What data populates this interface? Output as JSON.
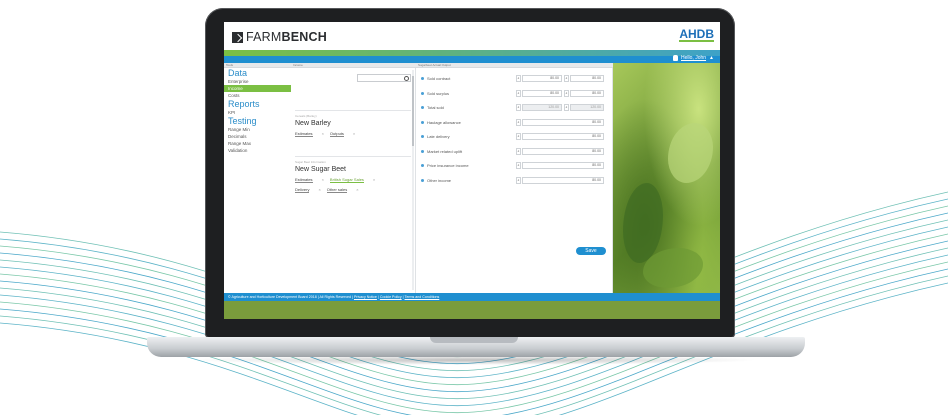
{
  "colors": {
    "brand_blue": "#1f8fd0",
    "brand_green": "#7bbf43",
    "heading_blue": "#2b8dc9"
  },
  "header": {
    "logo_left": "FARM",
    "logo_right": "BENCH",
    "logo_mark_icon": "farmbench-logo-icon",
    "partner_logo": "AHDB",
    "user_greeting": "Hello, John",
    "user_icon": "person-icon",
    "dropdown_icon": "chevron-down-icon"
  },
  "panels": {
    "tools_title": "Tools",
    "middle_title": "Income",
    "right_title": "Sugarbeet Actual Output"
  },
  "sidebar": {
    "sections": [
      {
        "heading": "Data",
        "items": [
          {
            "label": "Enterprise",
            "active": false
          },
          {
            "label": "Income",
            "active": true
          },
          {
            "label": "Costs",
            "active": false
          }
        ]
      },
      {
        "heading": "Reports",
        "items": [
          {
            "label": "KPI",
            "active": false
          }
        ]
      },
      {
        "heading": "Testing",
        "items": [
          {
            "label": "Range Min",
            "active": false
          },
          {
            "label": "Decimals",
            "active": false
          },
          {
            "label": "Range Max",
            "active": false
          },
          {
            "label": "Validation",
            "active": false
          }
        ]
      }
    ]
  },
  "middle": {
    "search_placeholder": "",
    "search_icon": "search-icon",
    "cards": [
      {
        "small": "Cereals (Barley)",
        "title": "New Barley",
        "chips": [
          {
            "label": "Estimates",
            "green": false
          },
          {
            "label": "Outputs",
            "green": false
          }
        ]
      },
      {
        "small": "Sugar Beet Information",
        "title": "New Sugar Beet",
        "chips": [
          {
            "label": "Estimates",
            "green": false
          },
          {
            "label": "British Sugar Sales",
            "green": true
          },
          {
            "label": "Delivery",
            "green": false
          },
          {
            "label": "Other sales",
            "green": false
          }
        ]
      }
    ]
  },
  "form": {
    "rows": [
      {
        "label": "Sold contract",
        "value1": "80.00",
        "value2": "80.00",
        "grey": false
      },
      {
        "label": "Sold surplus",
        "value1": "80.00",
        "value2": "80.00",
        "grey": false
      },
      {
        "label": "Total sold",
        "value1": "120.00",
        "value2": "120.00",
        "grey": true
      },
      {
        "label": "Haulage allowance",
        "value1": "80.00",
        "value2": "",
        "grey": false
      },
      {
        "label": "Late delivery",
        "value1": "80.00",
        "value2": "",
        "grey": false
      },
      {
        "label": "Market related uplift",
        "value1": "80.00",
        "value2": "",
        "grey": false
      },
      {
        "label": "Price insurance income",
        "value1": "80.00",
        "value2": "",
        "grey": false
      },
      {
        "label": "Other income",
        "value1": "80.00",
        "value2": "",
        "grey": false
      }
    ],
    "save_label": "Save"
  },
  "footer": {
    "copyright": "© Agriculture and Horticulture Development Board 2018 | All Rights Reserved | ",
    "privacy": "Privacy Notice",
    "cookie": "Cookie Policy",
    "terms": "Terms and Conditions"
  }
}
